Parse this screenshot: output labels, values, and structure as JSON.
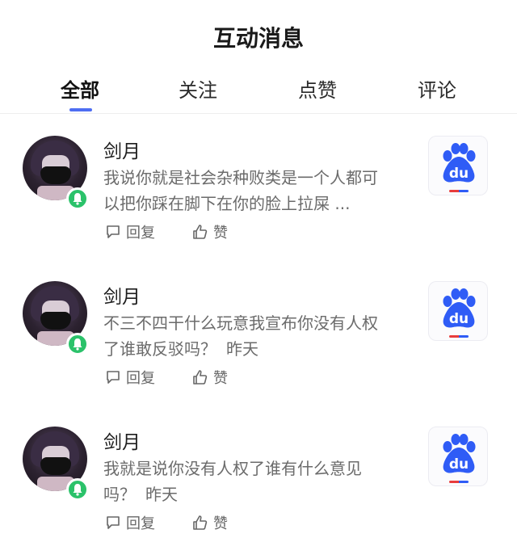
{
  "header": {
    "title": "互动消息"
  },
  "tabs": [
    {
      "label": "全部",
      "active": true
    },
    {
      "label": "关注",
      "active": false
    },
    {
      "label": "点赞",
      "active": false
    },
    {
      "label": "评论",
      "active": false
    }
  ],
  "colors": {
    "accent": "#4e6ef2",
    "online_badge": "#2bc26a",
    "baidu_blue": "#2f5cf6",
    "baidu_red": "#e83c3c"
  },
  "messages": [
    {
      "name": "剑月",
      "content": "我说你就是社会杂种败类是一个人都可以把你踩在脚下在你的脸上拉屎 ...",
      "time": "",
      "reply_label": "回复",
      "like_label": "赞",
      "thumbnail_icon": "baidu-du-logo"
    },
    {
      "name": "剑月",
      "content": "不三不四干什么玩意我宣布你没有人权了谁敢反驳吗？",
      "time": "昨天",
      "reply_label": "回复",
      "like_label": "赞",
      "thumbnail_icon": "baidu-du-logo"
    },
    {
      "name": "剑月",
      "content": "我就是说你没有人权了谁有什么意见吗？",
      "time": "昨天",
      "reply_label": "回复",
      "like_label": "赞",
      "thumbnail_icon": "baidu-du-logo"
    }
  ]
}
